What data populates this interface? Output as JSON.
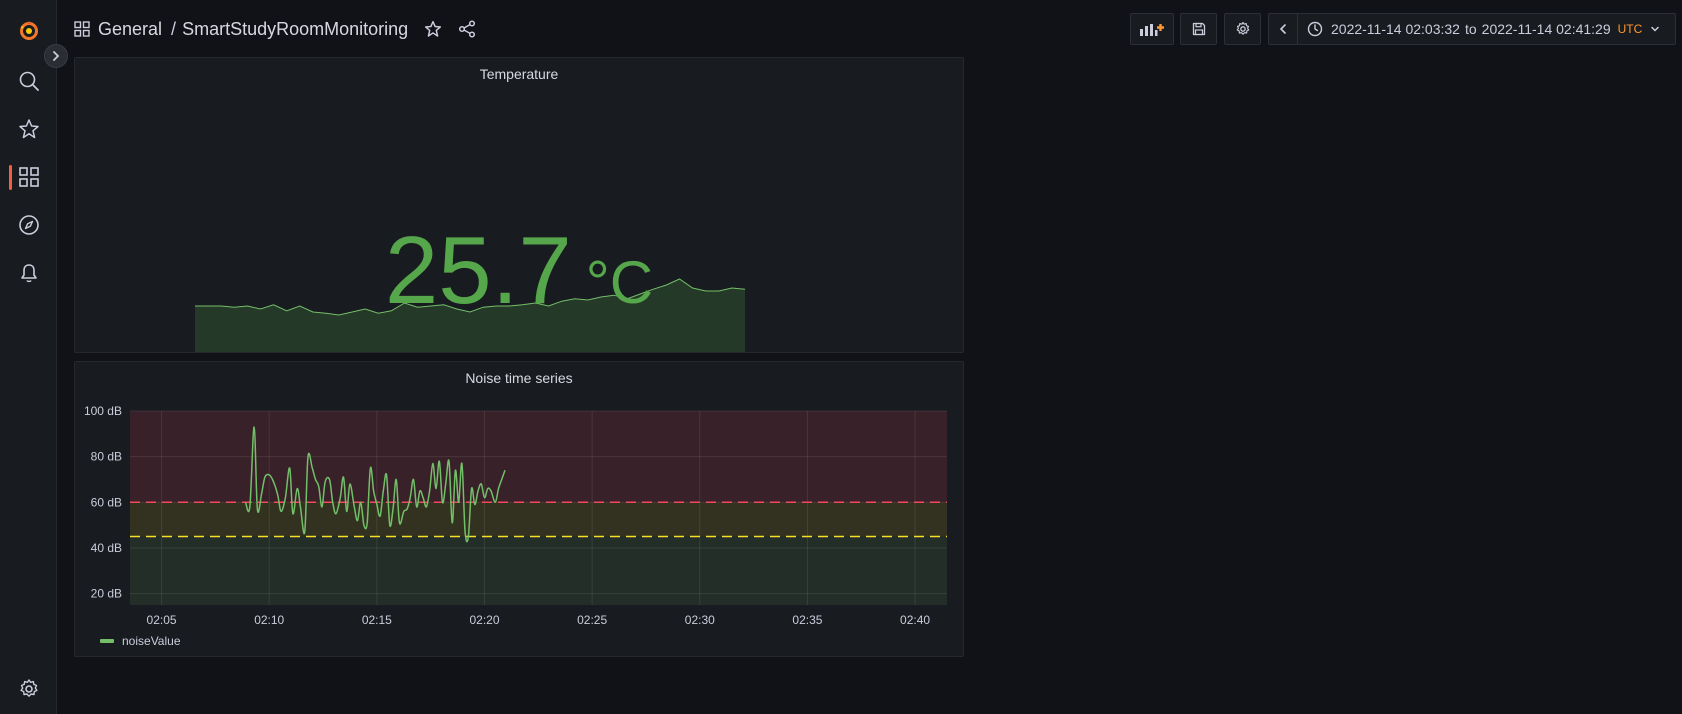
{
  "sidemenu": {
    "items": [
      {
        "name": "grafana-logo-icon"
      },
      {
        "name": "search-icon"
      },
      {
        "name": "star-icon"
      },
      {
        "name": "dashboards-icon"
      },
      {
        "name": "explore-icon"
      },
      {
        "name": "alerting-bell-icon"
      },
      {
        "name": "gear-icon"
      }
    ],
    "active": "dashboards-icon"
  },
  "breadcrumb": {
    "folder": "General",
    "separator": "/",
    "dashboard": "SmartStudyRoomMonitoring"
  },
  "toolbar": {
    "time_from": "2022-11-14 02:03:32",
    "time_to_word": "to",
    "time_to": "2022-11-14 02:41:29",
    "timezone": "UTC"
  },
  "colors": {
    "stat_green": "#56a64b",
    "series_green": "#73bf69",
    "threshold_red": "#f2495c",
    "threshold_yellow": "#fade2a",
    "accent_orange": "#ff9830"
  },
  "panels": {
    "temperature": {
      "title": "Temperature",
      "value": "25.7",
      "unit": "°C",
      "sparkline": [
        25.2,
        25.2,
        25.2,
        25.18,
        25.2,
        25.15,
        25.22,
        25.12,
        25.2,
        25.1,
        25.08,
        25.05,
        25.1,
        25.15,
        25.08,
        25.12,
        25.25,
        25.18,
        25.2,
        25.22,
        25.15,
        25.1,
        25.18,
        25.2,
        25.2,
        25.22,
        25.25,
        25.2,
        25.28,
        25.32,
        25.3,
        25.35,
        25.38,
        25.32,
        25.4,
        25.48,
        25.55,
        25.65,
        25.5,
        25.45,
        25.45,
        25.5,
        25.48
      ]
    },
    "noise": {
      "title": "Noise time series",
      "legend": "noiseValue"
    }
  },
  "chart_data": {
    "type": "line",
    "title": "Noise time series",
    "xlabel": "",
    "ylabel": "",
    "x_ticks": [
      "02:05",
      "02:10",
      "02:15",
      "02:20",
      "02:25",
      "02:30",
      "02:35",
      "02:40"
    ],
    "y_ticks": [
      "20 dB",
      "40 dB",
      "60 dB",
      "80 dB",
      "100 dB"
    ],
    "ylim": [
      15,
      100
    ],
    "xlim": [
      "02:03:32",
      "02:41:29"
    ],
    "thresholds": [
      {
        "value": 45,
        "color": "#fade2a"
      },
      {
        "value": 60,
        "color": "#f2495c"
      }
    ],
    "grid": true,
    "legend_position": "bottom-left",
    "series": [
      {
        "name": "noiseValue",
        "color": "#73bf69",
        "x_minutes": [
          8.9,
          9.1,
          9.3,
          9.45,
          9.65,
          9.8,
          10.0,
          10.2,
          10.4,
          10.55,
          10.75,
          10.95,
          11.1,
          11.3,
          11.45,
          11.65,
          11.8,
          12.0,
          12.15,
          12.3,
          12.45,
          12.6,
          12.8,
          12.95,
          13.1,
          13.3,
          13.45,
          13.6,
          13.75,
          13.95,
          14.1,
          14.25,
          14.4,
          14.55,
          14.7,
          14.85,
          15.0,
          15.15,
          15.3,
          15.45,
          15.6,
          15.75,
          15.9,
          16.05,
          16.25,
          16.4,
          16.55,
          16.7,
          16.85,
          17.0,
          17.15,
          17.3,
          17.45,
          17.6,
          17.75,
          17.9,
          18.05,
          18.2,
          18.35,
          18.5,
          18.65,
          18.8,
          18.95,
          19.1,
          19.25,
          19.4,
          19.55,
          19.7,
          19.85,
          20.0,
          20.15,
          20.3,
          20.5,
          20.65,
          20.8,
          20.95
        ],
        "y": [
          60,
          58,
          93,
          57,
          64,
          71,
          72,
          69,
          63,
          56,
          62,
          75,
          55,
          66,
          58,
          47,
          80,
          75,
          70,
          67,
          58,
          69,
          70,
          60,
          55,
          62,
          71,
          56,
          68,
          58,
          52,
          60,
          50,
          51,
          75,
          65,
          59,
          54,
          65,
          72,
          50,
          57,
          70,
          51,
          56,
          57,
          62,
          70,
          58,
          65,
          62,
          58,
          65,
          77,
          66,
          78,
          60,
          68,
          78,
          51,
          74,
          60,
          77,
          47,
          45,
          66,
          59,
          65,
          68,
          62,
          66,
          65,
          60,
          66,
          70,
          74
        ]
      }
    ]
  }
}
